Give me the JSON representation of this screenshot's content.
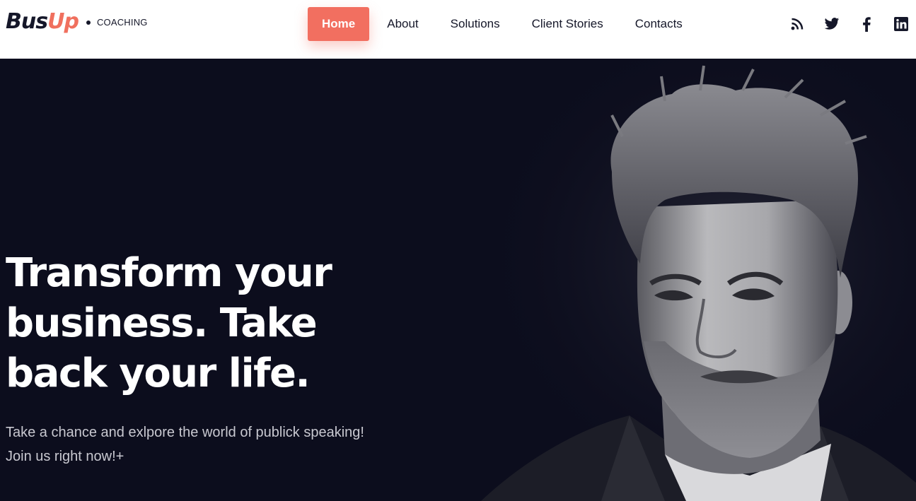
{
  "brand": {
    "logo_part1": "Bus",
    "logo_part2": "Up",
    "tagline": "COACHING",
    "accent_color": "#f26f60",
    "dark_color": "#151729"
  },
  "nav": {
    "items": [
      {
        "label": "Home",
        "active": true
      },
      {
        "label": "About",
        "active": false
      },
      {
        "label": "Solutions",
        "active": false
      },
      {
        "label": "Client Stories",
        "active": false
      },
      {
        "label": "Contacts",
        "active": false
      }
    ]
  },
  "social": [
    {
      "icon": "rss-icon"
    },
    {
      "icon": "twitter-icon"
    },
    {
      "icon": "facebook-icon"
    },
    {
      "icon": "linkedin-icon"
    }
  ],
  "hero": {
    "title_line1": "Transform your",
    "title_line2": "business. Take",
    "title_line3": "back your life.",
    "subtitle_line1": "Take a chance and exlpore the world of publick speaking!",
    "subtitle_line2": "Join us right now!+",
    "background_color": "#0c0d1d"
  }
}
